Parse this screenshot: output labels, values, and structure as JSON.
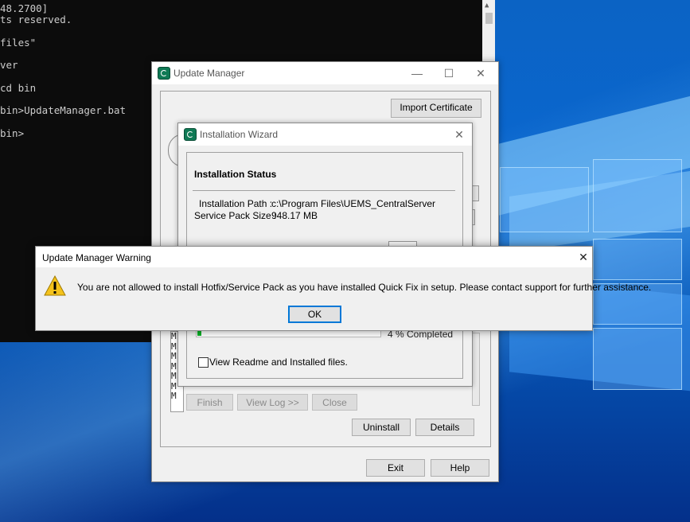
{
  "console": {
    "lines": [
      "48.2700]",
      "ts reserved.",
      "",
      "files\"",
      "",
      "ver",
      "",
      "cd bin",
      "",
      "bin>UpdateManager.bat",
      "",
      "bin>"
    ]
  },
  "update_manager": {
    "title": "Update Manager",
    "import_certificate": "Import Certificate",
    "uninstall": "Uninstall",
    "details": "Details",
    "exit": "Exit",
    "help": "Help",
    "list_letter": "M"
  },
  "wizard": {
    "title": "Installation Wizard",
    "status_heading": "Installation Status",
    "install_path_label": "Installation Path :",
    "install_path_value": "c:\\Program Files\\UEMS_CentralServer",
    "size_label": "Service Pack Size :",
    "size_value": "948.17 MB",
    "progress_text": "4 % Completed",
    "progress_percent": 4,
    "readme_label": "View Readme and Installed files.",
    "finish": "Finish",
    "view_log": "View Log >>",
    "close": "Close"
  },
  "warning": {
    "title": "Update Manager Warning",
    "message": "You are not allowed to install Hotfix/Service Pack as you have installed Quick Fix in setup. Please contact support for further assistance.",
    "ok": "OK"
  }
}
